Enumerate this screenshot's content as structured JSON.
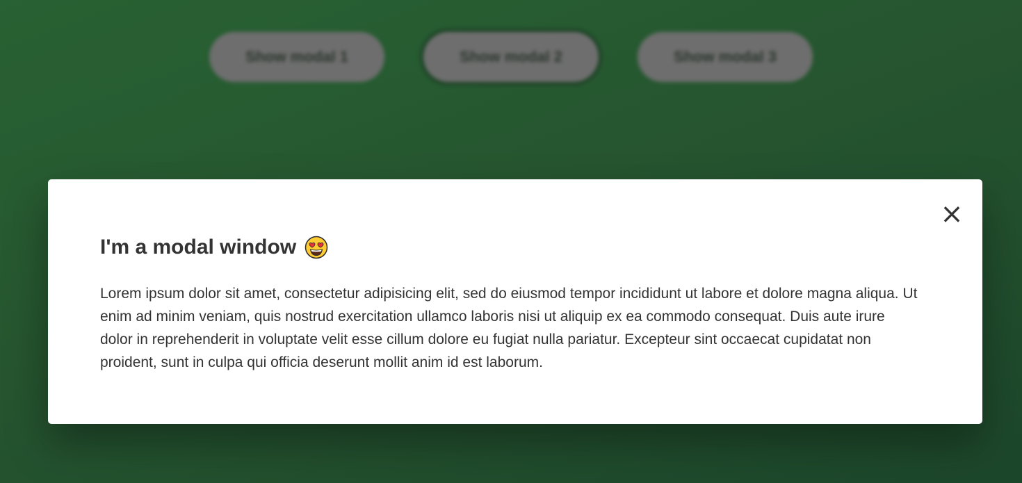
{
  "page": {
    "background_colors": [
      "#2c6a38",
      "#1f4d2e"
    ]
  },
  "buttons": [
    {
      "label": "Show modal 1"
    },
    {
      "label": "Show modal 2"
    },
    {
      "label": "Show modal 3"
    }
  ],
  "modal": {
    "title": "I'm a modal window",
    "title_icon": "heart-eyes-emoji-icon",
    "close_label": "×",
    "close_icon": "close-icon",
    "body": "Lorem ipsum dolor sit amet, consectetur adipisicing elit, sed do eiusmod tempor incididunt ut labore et dolore magna aliqua. Ut enim ad minim veniam, quis nostrud exercitation ullamco laboris nisi ut aliquip ex ea commodo consequat. Duis aute irure dolor in reprehenderit in voluptate velit esse cillum dolore eu fugiat nulla pariatur. Excepteur sint occaecat cupidatat non proident, sunt in culpa qui officia deserunt mollit anim id est laborum."
  }
}
